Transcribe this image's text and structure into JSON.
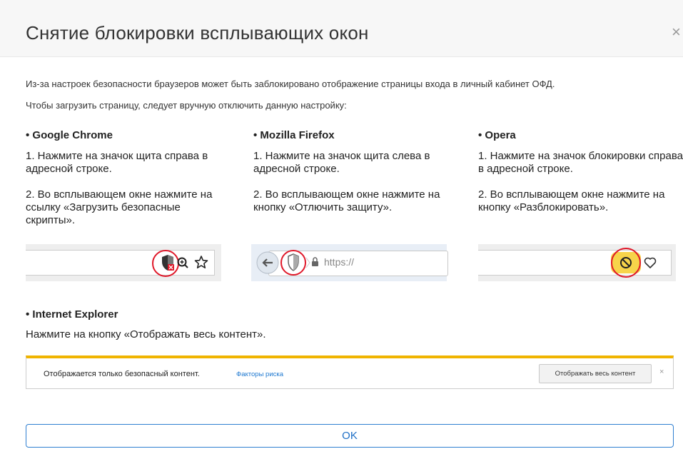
{
  "dialog": {
    "title": "Снятие блокировки всплывающих окон",
    "close": "×",
    "intro_line1": "Из-за настроек безопасности браузеров может быть заблокировано отображение страницы входа в личный кабинет ОФД.",
    "intro_line2": "Чтобы загрузить страницу, следует вручную отключить данную настройку:"
  },
  "browsers": [
    {
      "name": "• Google Chrome",
      "step1": "1. Нажмите на значок щита справа в адресной строке.",
      "step2": "2. Во всплывающем окне нажмите на ссылку «Загрузить безопасные скрипты»."
    },
    {
      "name": "• Mozilla Firefox",
      "step1": "1. Нажмите на значок щита слева в адресной строке.",
      "step2": "2. Во всплывающем окне нажмите на кнопку «Отлючить защиту»."
    },
    {
      "name": "• Opera",
      "step1": "1. Нажмите на значок блокировки справа в адресной строке.",
      "step2": "2. Во всплывающем окне нажмите на кнопку «Разблокировать»."
    }
  ],
  "firefox_url": "https://",
  "ie": {
    "name": "• Internet Explorer",
    "text": "Нажмите на кнопку «Отображать весь контент».",
    "bar_message": "Отображается только безопасный контент.",
    "bar_link": "Факторы риска",
    "bar_button": "Отображать весь контент",
    "bar_close": "×"
  },
  "ok_label": "OK",
  "colors": {
    "accent": "#2f7fd1",
    "highlight_ring": "#e0192a",
    "ie_bar": "#f0b400",
    "opera_badge": "#f7d44a"
  },
  "icons": [
    "shield-blocked-icon",
    "zoom-icon",
    "star-icon",
    "back-arrow-icon",
    "shield-icon",
    "lock-icon",
    "blocked-icon",
    "heart-icon"
  ]
}
